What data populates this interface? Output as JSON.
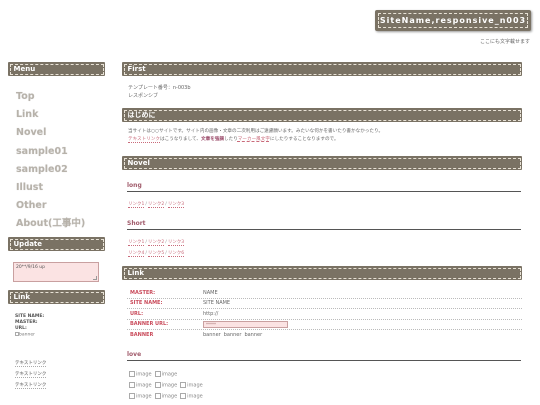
{
  "header": {
    "site_name": "SiteName,responsive_n003",
    "tagline": "ここにも文字載せます"
  },
  "sidebar": {
    "menu_title": "Menu",
    "menu_items": [
      "Top",
      "Link",
      "Novel",
      "sample01",
      "sample02",
      "Illust",
      "Other",
      "About(工事中)"
    ],
    "update_title": "Update",
    "update_text": "20**/9/16 up",
    "link_title": "Link",
    "link_info": [
      "SITE NAME:",
      "MASTER:",
      "URL:"
    ],
    "banner_alt": "banner",
    "text_links": [
      "テキストリンク",
      "テキストリンク",
      "テキストリンク"
    ]
  },
  "main": {
    "first_title": "First",
    "first_lines": [
      "テンプレート番号：n-003b",
      "レスポンシブ"
    ],
    "hajime_title": "はじめに",
    "hajime_line1": "当サイトは○○サイトです。サイト内の画像・文章の二次利用はご遠慮願います。みたいな何かを書いたり書かなかったり。",
    "hajime_line2_a": "テキストリンク",
    "hajime_line2_b": "はこうなりまして、",
    "hajime_line2_c": "文章を強調",
    "hajime_line2_d": "したり",
    "hajime_line2_e": "マーカー風文字",
    "hajime_line2_f": "にしたりすることなりますので。",
    "novel_title": "Novel",
    "long_title": "long",
    "long_links": [
      "リンク1",
      "リンク2",
      "リンク3"
    ],
    "short_title": "Short",
    "short_links_1": [
      "リンク1",
      "リンク2",
      "リンク3"
    ],
    "short_links_2": [
      "リンク4",
      "リンク5",
      "リンク6"
    ],
    "link_title": "Link",
    "link_table": [
      {
        "key": "MASTER:",
        "value": "NAME"
      },
      {
        "key": "SITE NAME:",
        "value": "SITE NAME"
      },
      {
        "key": "URL:",
        "value": "http://"
      },
      {
        "key": "BANNER URL:",
        "value": "*****"
      },
      {
        "key": "BANNER",
        "value": ""
      }
    ],
    "banner_alts": [
      "banner",
      "banner",
      "banner"
    ],
    "love_title": "love",
    "image_alt": "image"
  },
  "colors": {
    "header_bg": "#7a7264",
    "accent": "#c96a7a",
    "pink_field": "#fbe3e3"
  }
}
